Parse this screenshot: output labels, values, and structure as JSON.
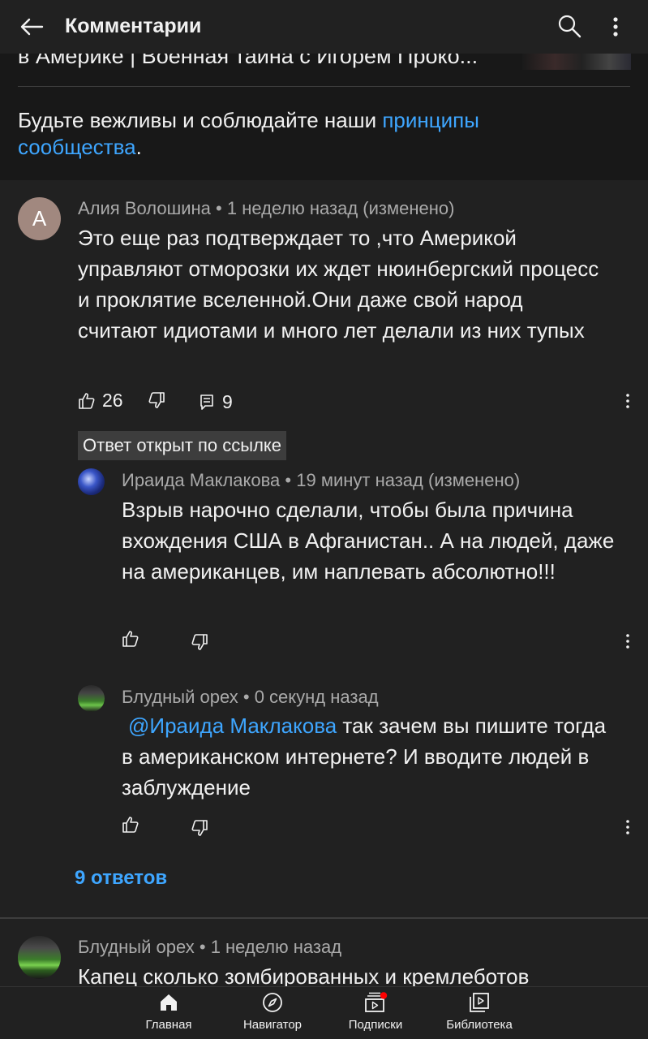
{
  "topbar": {
    "title": "Комментарии",
    "back_icon": "arrow-left-icon",
    "search_icon": "search-icon",
    "more_icon": "more-vertical-icon"
  },
  "video": {
    "title": "в Америке | Военная тайна с Игорем Проко..."
  },
  "guidelines": {
    "text": "Будьте вежливы и соблюдайте наши ",
    "link": "принципы сообщества",
    "end": "."
  },
  "comments": [
    {
      "avatar_letter": "А",
      "author": "Алия Волошина",
      "time": "1 неделю назад (изменено)",
      "text": "Это еще раз подтверждает то ,что Америкой управляют отморозки их ждет нюинбергский процесс и проклятие вселенной.Они даже свой народ считают идиотами и много лет делали из них тупых",
      "likes": "26",
      "replies": "9"
    }
  ],
  "linked_tag": "Ответ открыт по ссылке",
  "replies": [
    {
      "author": "Ираида Маклакова",
      "time": "19 минут назад (изменено)",
      "text": "Взрыв нарочно сделали, чтобы была причина вхождения США в Афганистан.. А на людей, даже на американцев, им наплевать абсолютно!!!"
    },
    {
      "author": "Блудный орех",
      "time": "0 секунд назад",
      "mention": "@Ираида Маклакова",
      "text": " так зачем вы пишите тогда в американском интернете? И вводите людей в заблуждение"
    }
  ],
  "replies_link": "9 ответов",
  "next_comment": {
    "author": "Блудный орех",
    "time": "1 неделю назад",
    "text": "Капец сколько зомбированных и кремлеботов"
  },
  "separator": "•",
  "bottom_nav": [
    {
      "label": "Главная",
      "icon": "home-icon"
    },
    {
      "label": "Навигатор",
      "icon": "compass-icon"
    },
    {
      "label": "Подписки",
      "icon": "subscriptions-icon"
    },
    {
      "label": "Библиотека",
      "icon": "library-icon"
    }
  ],
  "colors": {
    "background": "#212121",
    "header_bg": "#181818",
    "link": "#3ea6ff",
    "meta": "#aaaaaa",
    "avatar_a": "#a1887f",
    "notification": "#ff0000"
  }
}
